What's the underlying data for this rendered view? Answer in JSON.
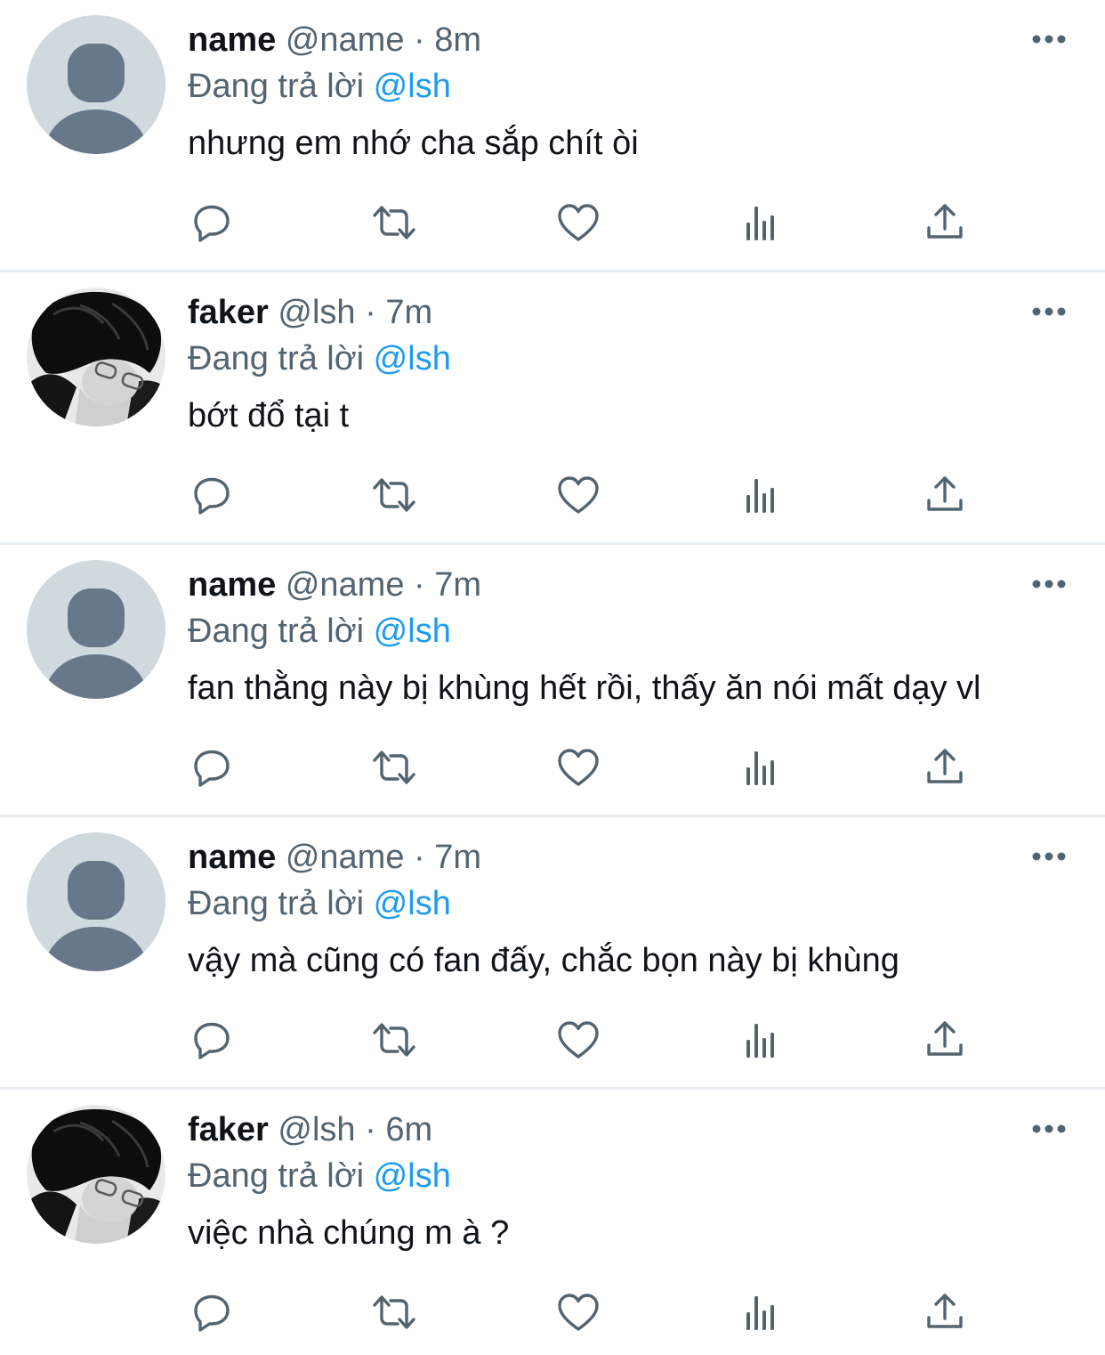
{
  "tweets": [
    {
      "display_name": "name",
      "handle": "@name",
      "time": "8m",
      "reply_prefix": "Đang trả lời",
      "reply_to": "@lsh",
      "text": "nhưng em nhớ cha sắp chít òi",
      "avatar": "default"
    },
    {
      "display_name": "faker",
      "handle": "@lsh",
      "time": "7m",
      "reply_prefix": "Đang trả lời",
      "reply_to": "@lsh",
      "text": "bớt đổ tại t",
      "avatar": "photo"
    },
    {
      "display_name": "name",
      "handle": "@name",
      "time": "7m",
      "reply_prefix": "Đang trả lời",
      "reply_to": "@lsh",
      "text": "fan thằng này bị khùng hết rồi, thấy ăn nói mất dạy vl",
      "avatar": "default"
    },
    {
      "display_name": "name",
      "handle": "@name",
      "time": "7m",
      "reply_prefix": "Đang trả lời",
      "reply_to": "@lsh",
      "text": "vậy mà cũng có fan đấy, chắc bọn này bị khùng",
      "avatar": "default"
    },
    {
      "display_name": "faker",
      "handle": "@lsh",
      "time": "6m",
      "reply_prefix": "Đang trả lời",
      "reply_to": "@lsh",
      "text": "việc nhà chúng m à ?",
      "avatar": "photo"
    }
  ],
  "separator": "·",
  "icons": {
    "reply": "reply-icon",
    "retweet": "retweet-icon",
    "like": "like-icon",
    "views": "views-icon",
    "share": "share-icon",
    "more": "more-icon"
  },
  "colors": {
    "text": "#0f1419",
    "secondary": "#536471",
    "mention": "#1d9bf0",
    "divider": "#e6ecf0",
    "default_avatar_bg": "#cfd9de",
    "default_avatar_fg": "#66788a"
  }
}
